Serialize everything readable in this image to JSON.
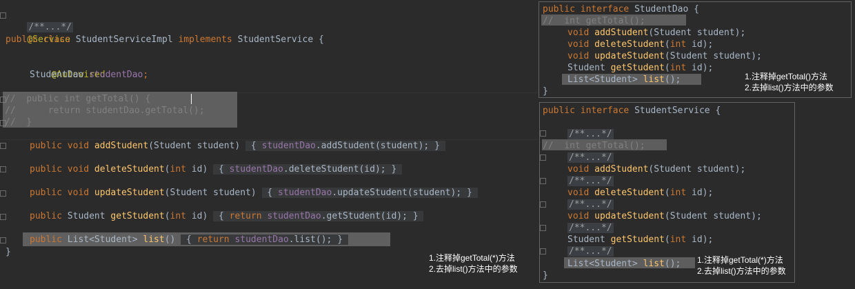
{
  "main_editor": {
    "lines": [
      {
        "fold": "/**...*/"
      },
      {
        "annotation": "@Service"
      },
      {
        "kw1": "public",
        "kw2": "class",
        "name": "StudentServiceImpl",
        "kw3": "implements",
        "iface": "StudentService",
        "brace": "{"
      },
      {
        "annotation": "@Autowired"
      },
      {
        "type": "StudentDao",
        "field": "studentDao",
        "semi": ";"
      },
      {
        "comment1": "//  public int getTotal() {",
        "comment2": "//      return studentDao.getTotal();",
        "comment3": "//  }"
      },
      {
        "kw": "public void",
        "method": "addStudent",
        "params": "(Student student)",
        "body_open": "{",
        "body_field": "studentDao",
        "body_call": ".addStudent(student);",
        "body_close": "}"
      },
      {
        "kw": "public void",
        "method": "deleteStudent",
        "params_open": "(",
        "params_kw": "int",
        "params_rest": " id)",
        "body_open": "{",
        "body_field": "studentDao",
        "body_call": ".deleteStudent(id);",
        "body_close": "}"
      },
      {
        "kw": "public void",
        "method": "updateStudent",
        "params": "(Student student)",
        "body_open": "{",
        "body_field": "studentDao",
        "body_call": ".updateStudent(student);",
        "body_close": "}"
      },
      {
        "kw": "public",
        "type": "Student",
        "method": "getStudent",
        "params_open": "(",
        "params_kw": "int",
        "params_rest": " id)",
        "body_open": "{",
        "ret": "return",
        "body_field": "studentDao",
        "body_call": ".getStudent(id);",
        "body_close": "}"
      },
      {
        "kw": "public",
        "type": "List<Student>",
        "method": "list",
        "params": "()",
        "body_open": "{",
        "ret": "return",
        "body_field": "studentDao",
        "body_call": ".list();",
        "body_close": "}"
      },
      {
        "close": "}"
      }
    ],
    "note": "1.注释掉getTotal(*)方法\n2.去掉list()方法中的参数"
  },
  "dao_panel": {
    "header_kw": "public interface",
    "header_name": "StudentDao",
    "header_brace": "{",
    "commented": "//  int getTotal();",
    "methods": [
      {
        "ret": "void",
        "name": "addStudent",
        "args": "(Student student);"
      },
      {
        "ret": "void",
        "name": "deleteStudent",
        "args_open": "(",
        "args_kw": "int",
        "args_rest": " id);"
      },
      {
        "ret": "void",
        "name": "updateStudent",
        "args": "(Student student);"
      },
      {
        "ret": "Student",
        "name": "getStudent",
        "args_open": "(",
        "args_kw": "int",
        "args_rest": " id);"
      },
      {
        "ret": "List<Student>",
        "name": "list",
        "args": "();"
      }
    ],
    "close": "}",
    "note": "1.注释掉getTotal()方法\n2.去掉list()方法中的参数"
  },
  "service_panel": {
    "header_kw": "public interface",
    "header_name": "StudentService",
    "header_brace": "{",
    "fold": "/**...*/",
    "commented": "//  int getTotal();",
    "methods": [
      {
        "ret": "void",
        "name": "addStudent",
        "args": "(Student student);"
      },
      {
        "ret": "void",
        "name": "deleteStudent",
        "args_open": "(",
        "args_kw": "int",
        "args_rest": " id);"
      },
      {
        "ret": "void",
        "name": "updateStudent",
        "args": "(Student student);"
      },
      {
        "ret": "Student",
        "name": "getStudent",
        "args_open": "(",
        "args_kw": "int",
        "args_rest": " id);"
      },
      {
        "ret": "List<Student>",
        "name": "list",
        "args": "();"
      }
    ],
    "close": "}",
    "note": "1.注释掉getTotal(*)方法\n2.去掉list()方法中的参数"
  }
}
